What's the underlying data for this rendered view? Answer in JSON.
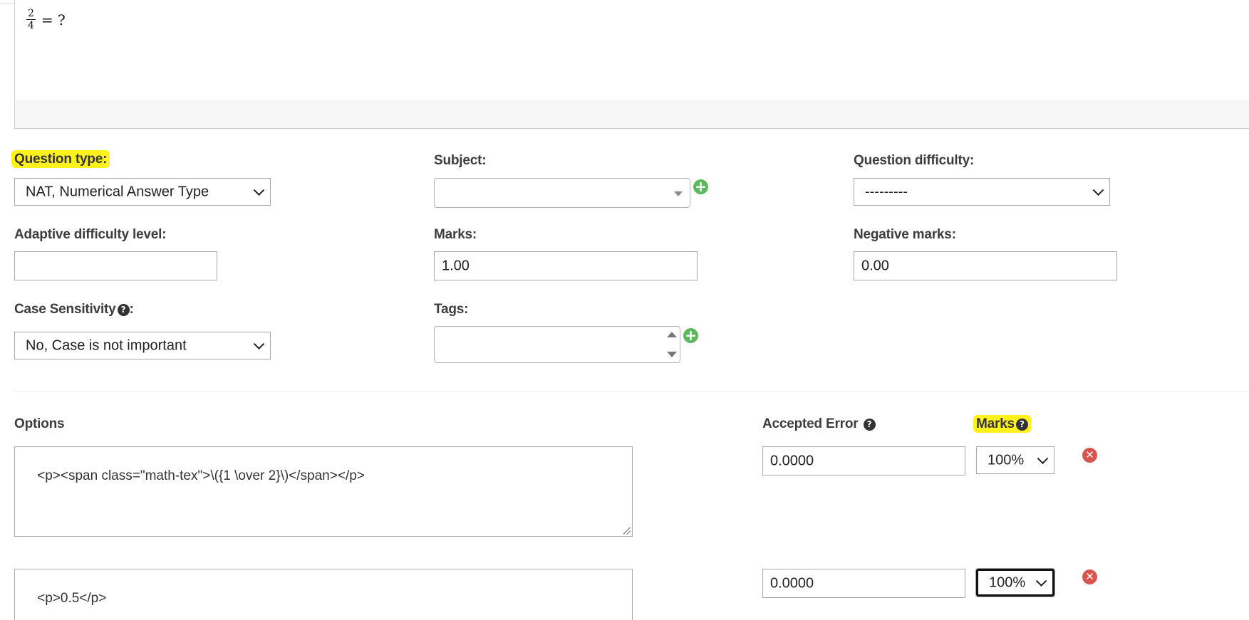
{
  "question_preview": {
    "numerator": "2",
    "denominator": "4",
    "rest": "= ?"
  },
  "question_type": {
    "label": "Question type:",
    "value": "NAT, Numerical Answer Type"
  },
  "subject": {
    "label": "Subject:",
    "value": ""
  },
  "question_difficulty": {
    "label": "Question difficulty:",
    "value": "---------"
  },
  "adaptive_difficulty": {
    "label": "Adaptive difficulty level:",
    "value": ""
  },
  "marks": {
    "label": "Marks:",
    "value": "1.00"
  },
  "negative_marks": {
    "label": "Negative marks:",
    "value": "0.00"
  },
  "case_sensitivity": {
    "label_text": "Case Sensitivity",
    "colon": ":",
    "value": "No, Case is not important"
  },
  "tags": {
    "label": "Tags:",
    "value": ""
  },
  "options_section": {
    "options_header": "Options",
    "accepted_error_header": "Accepted Error",
    "marks_header": "Marks",
    "rows": [
      {
        "option_text": "<p><span class=\"math-tex\">\\({1 \\over 2}\\)</span></p>",
        "accepted_error": "0.0000",
        "marks_percent": "100%"
      },
      {
        "option_text": "<p>0.5</p>",
        "accepted_error": "0.0000",
        "marks_percent": "100%"
      }
    ]
  },
  "icons": {
    "help": "question-circle-icon",
    "add": "plus-circle-icon",
    "remove": "times-circle-icon"
  },
  "colors": {
    "highlight": "#fff21c",
    "add_green": "#5cb85c",
    "remove_red": "#d9534f"
  }
}
